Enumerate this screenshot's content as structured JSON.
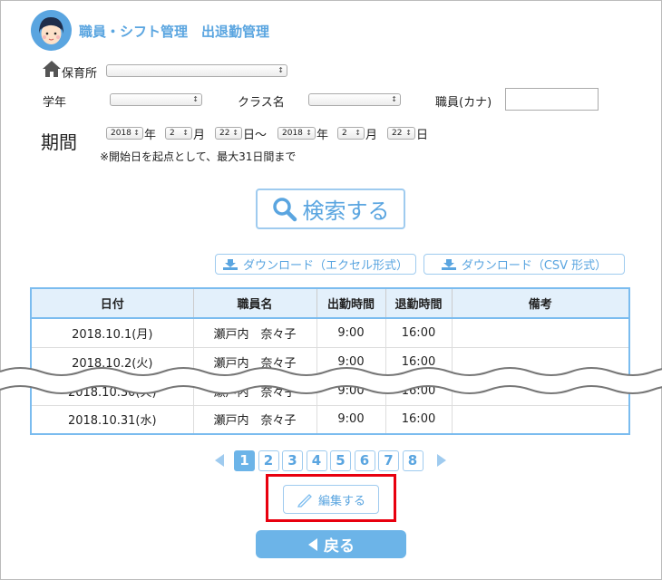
{
  "header": {
    "title": "職員・シフト管理　出退勤管理"
  },
  "filters": {
    "nursery_label": "保育所",
    "grade_label": "学年",
    "class_label": "クラス名",
    "staff_kana_label": "職員(カナ)",
    "staff_kana_value": ""
  },
  "period": {
    "label": "期間",
    "start_year": "2018",
    "start_month": "2",
    "start_day": "22",
    "end_year": "2018",
    "end_month": "2",
    "end_day": "22",
    "year_unit": "年",
    "month_unit": "月",
    "day_unit_range": "日〜",
    "day_unit": "日",
    "note": "※開始日を起点として、最大31日間まで"
  },
  "search_label": "検索する",
  "downloads": {
    "excel": "ダウンロード（エクセル形式）",
    "csv": "ダウンロード（CSV 形式）"
  },
  "table": {
    "headers": [
      "日付",
      "職員名",
      "出勤時間",
      "退勤時間",
      "備考"
    ],
    "rows": [
      [
        "2018.10.1(月)",
        "瀬戸内　奈々子",
        "9:00",
        "16:00",
        ""
      ],
      [
        "2018.10.2(火)",
        "瀬戸内　奈々子",
        "9:00",
        "16:00",
        ""
      ],
      [
        "2018.10.30(火)",
        "瀬戸内　奈々子",
        "9:00",
        "16:00",
        ""
      ],
      [
        "2018.10.31(水)",
        "瀬戸内　奈々子",
        "9:00",
        "16:00",
        ""
      ]
    ]
  },
  "pagination": {
    "pages": [
      "1",
      "2",
      "3",
      "4",
      "5",
      "6",
      "7",
      "8"
    ],
    "current": "1"
  },
  "edit_label": "編集する",
  "back_label": "戻る"
}
